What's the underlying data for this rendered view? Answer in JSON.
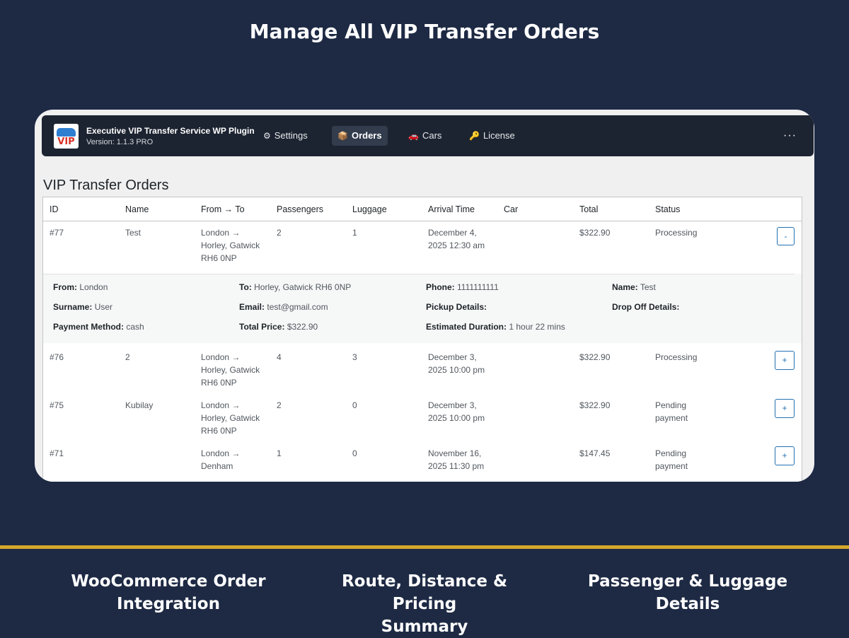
{
  "headline": "Manage All VIP Transfer Orders",
  "app": {
    "logo_text": "VIP",
    "name": "Executive VIP Transfer Service WP Plugin",
    "version": "Version: 1.1.3 PRO"
  },
  "nav": {
    "items": [
      {
        "label": "Settings",
        "icon": "gear-icon",
        "glyph": "⚙"
      },
      {
        "label": "Orders",
        "icon": "package-icon",
        "glyph": "📦"
      },
      {
        "label": "Cars",
        "icon": "car-icon",
        "glyph": "🚗"
      },
      {
        "label": "License",
        "icon": "key-icon",
        "glyph": "🔑"
      }
    ],
    "active": "Orders",
    "more_label": "···"
  },
  "page_title": "VIP Transfer Orders",
  "table": {
    "columns": [
      "ID",
      "Name",
      "From → To",
      "Passengers",
      "Luggage",
      "Arrival Time",
      "Car",
      "Total",
      "Status"
    ],
    "rows": [
      {
        "id": "#77",
        "name": "Test",
        "route": [
          "London →",
          "Horley, Gatwick",
          "RH6 0NP"
        ],
        "passengers": "2",
        "luggage": "1",
        "arrival": [
          "December 4,",
          "2025 12:30 am"
        ],
        "car": "",
        "total": "$322.90",
        "status": [
          "Processing"
        ],
        "toggle": "-"
      },
      {
        "id": "#76",
        "name": "2",
        "route": [
          "London →",
          "Horley, Gatwick",
          "RH6 0NP"
        ],
        "passengers": "4",
        "luggage": "3",
        "arrival": [
          "December 3,",
          "2025 10:00 pm"
        ],
        "car": "",
        "total": "$322.90",
        "status": [
          "Processing"
        ],
        "toggle": "+"
      },
      {
        "id": "#75",
        "name": "Kubilay",
        "route": [
          "London →",
          "Horley, Gatwick",
          "RH6 0NP"
        ],
        "passengers": "2",
        "luggage": "0",
        "arrival": [
          "December 3,",
          "2025 10:00 pm"
        ],
        "car": "",
        "total": "$322.90",
        "status": [
          "Pending",
          "payment"
        ],
        "toggle": "+"
      },
      {
        "id": "#71",
        "name": "",
        "route": [
          "London →",
          "Denham"
        ],
        "passengers": "1",
        "luggage": "0",
        "arrival": [
          "November 16,",
          "2025 11:30 pm"
        ],
        "car": "",
        "total": "$147.45",
        "status": [
          "Pending",
          "payment"
        ],
        "toggle": "+"
      }
    ],
    "details": [
      {
        "label": "From:",
        "value": "London"
      },
      {
        "label": "To:",
        "value": "Horley, Gatwick RH6 0NP"
      },
      {
        "label": "Phone:",
        "value": "1111111111"
      },
      {
        "label": "Name:",
        "value": "Test"
      },
      {
        "label": "Surname:",
        "value": "User"
      },
      {
        "label": "Email:",
        "value": "test@gmail.com"
      },
      {
        "label": "Pickup Details:",
        "value": ""
      },
      {
        "label": "Drop Off Details:",
        "value": ""
      },
      {
        "label": "Payment Method:",
        "value": "cash"
      },
      {
        "label": "Total Price:",
        "value": "$322.90"
      },
      {
        "label": "Estimated Duration:",
        "value": "1 hour 22 mins"
      }
    ]
  },
  "features": [
    {
      "lines": [
        "WooCommerce Order",
        "Integration"
      ]
    },
    {
      "lines": [
        "Route, Distance & Pricing",
        "Summary"
      ]
    },
    {
      "lines": [
        "Passenger & Luggage",
        "Details"
      ]
    }
  ],
  "colors": {
    "background": "#1e2a44",
    "topbar": "#1d2431",
    "accent_gold": "#d4a82b",
    "button_blue": "#2271b1"
  }
}
